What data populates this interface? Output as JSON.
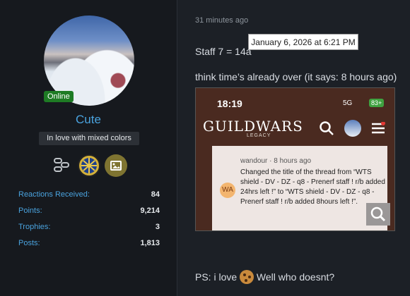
{
  "user": {
    "online_badge": "Online",
    "username": "Cute",
    "user_title": "In love with mixed colors",
    "stats": [
      {
        "label": "Reactions Received:",
        "value": "84"
      },
      {
        "label": "Points:",
        "value": "9,214"
      },
      {
        "label": "Trophies:",
        "value": "3"
      },
      {
        "label": "Posts:",
        "value": "1,813"
      }
    ]
  },
  "post": {
    "timestamp": "31 minutes ago",
    "tooltip": "January 6, 2026 at 6:21 PM",
    "line1": "Staff 7 = 14a",
    "line2": "think time’s already over (it says: 8 hours ago)",
    "line3_before": "PS: i love",
    "line3_after": "Well who doesnt?"
  },
  "embedded_screenshot": {
    "status_time": "18:19",
    "network": "5G",
    "battery": "83+",
    "logo": "GUILDWARS",
    "logo_sub": "LEGACY",
    "entry_meta": "wandour · 8 hours ago",
    "entry_text": "Changed the title of the thread from “WTS shield - DV - DZ - q8 - Prenerf staff ! r/b added 24hrs left !” to “WTS shield - DV - DZ - q8 - Prenerf staff ! r/b added 8hours left !”.",
    "avatar_initials": "WA"
  }
}
